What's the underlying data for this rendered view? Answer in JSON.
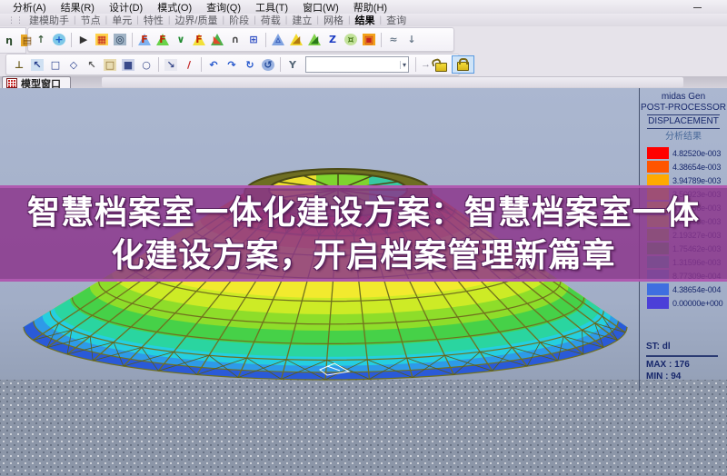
{
  "window": {
    "minimize_glyph": "—"
  },
  "menu": {
    "items": [
      "分析(A)",
      "结果(R)",
      "设计(D)",
      "模式(O)",
      "查询(Q)",
      "工具(T)",
      "窗口(W)",
      "帮助(H)"
    ]
  },
  "tab_strip": {
    "grip": "⋮⋮",
    "active_index": 9,
    "items": [
      "建模助手",
      "节点",
      "单元",
      "特性",
      "边界/质量",
      "阶段",
      "荷载",
      "建立",
      "网格",
      "结果",
      "查询"
    ]
  },
  "side_icons": [
    {
      "name": "eta-curve-icon",
      "glyph": "η",
      "color": "#2a4a2a",
      "shape": "none",
      "shape_color": ""
    },
    {
      "name": "orange-box-icon",
      "glyph": "▤",
      "color": "#7a4a0a",
      "shape": "rect",
      "shape_color": "#e8a82a"
    }
  ],
  "toolbar_results": {
    "icons": [
      {
        "name": "reaction-arrow-icon",
        "glyph": "↑",
        "color": "#3a5a3a",
        "shape": "none",
        "shape_color": ""
      },
      {
        "name": "node-web-icon",
        "glyph": "+",
        "color": "#1a5acc",
        "shape": "circ",
        "shape_color": "#7ec8e8"
      },
      {
        "sep": true
      },
      {
        "name": "animation-man-icon",
        "glyph": "▶",
        "color": "#333333",
        "shape": "none",
        "shape_color": ""
      },
      {
        "name": "result-table-icon",
        "glyph": "▦",
        "color": "#c22222",
        "shape": "rect",
        "shape_color": "#ffd24a"
      },
      {
        "name": "render-camera-icon",
        "glyph": "◎",
        "color": "#223a55",
        "shape": "rect",
        "shape_color": "#9fb2c4"
      },
      {
        "sep": true
      },
      {
        "name": "reaction-force-icon",
        "glyph": "F",
        "color": "#c22200",
        "shape": "tri",
        "shape_color": "#7fb2f0"
      },
      {
        "name": "deformed-shape-icon",
        "glyph": "F",
        "color": "#c22200",
        "shape": "tri",
        "shape_color": "#69d24a"
      },
      {
        "name": "displacement-curve-icon",
        "glyph": "∨",
        "color": "#1f8a2f",
        "shape": "none",
        "shape_color": ""
      },
      {
        "name": "moment-diagram-icon",
        "glyph": "F",
        "color": "#c22200",
        "shape": "tri",
        "shape_color": "#f2e03a"
      },
      {
        "name": "stress-wedge-icon",
        "glyph": "◣",
        "color": "#e04a2a",
        "shape": "tri",
        "shape_color": "#4ab24a"
      },
      {
        "name": "arc-arrow-icon",
        "glyph": "∩",
        "color": "#444444",
        "shape": "none",
        "shape_color": ""
      },
      {
        "name": "lattice-grid-icon",
        "glyph": "⊞",
        "color": "#2a4ac2",
        "shape": "none",
        "shape_color": ""
      },
      {
        "sep": true
      },
      {
        "name": "mode-shape-icon",
        "glyph": "▵",
        "color": "#2244aa",
        "shape": "tri",
        "shape_color": "#7fa2e0"
      },
      {
        "name": "yellow-wedge-icon",
        "glyph": "◢",
        "color": "#b27a10",
        "shape": "tri",
        "shape_color": "#f2d82a"
      },
      {
        "name": "green-wedge-icon",
        "glyph": "◢",
        "color": "#2a7a1a",
        "shape": "tri",
        "shape_color": "#7fd24a"
      },
      {
        "name": "z-displacement-icon",
        "glyph": "Z",
        "color": "#1a3ac2",
        "shape": "none",
        "shape_color": ""
      },
      {
        "name": "stage-pin-icon",
        "glyph": "¤",
        "color": "#4a7a1a",
        "shape": "circ",
        "shape_color": "#c2e29a"
      },
      {
        "name": "solid-cube-icon",
        "glyph": "▣",
        "color": "#c22222",
        "shape": "rect",
        "shape_color": "#f2a21a"
      },
      {
        "sep": true
      },
      {
        "name": "wave-function-icon",
        "glyph": "≈",
        "color": "#6a7a8a",
        "shape": "none",
        "shape_color": ""
      },
      {
        "name": "probe-result-icon",
        "glyph": "↓",
        "color": "#6a7a8a",
        "shape": "none",
        "shape_color": ""
      }
    ]
  },
  "toolbar_view": {
    "icons": [
      {
        "name": "plumb-pin-icon",
        "glyph": "⊥",
        "color": "#6a5a1a",
        "shape": "none",
        "shape_color": ""
      },
      {
        "name": "select-single-icon",
        "glyph": "↖",
        "color": "#223a8a",
        "shape": "rect",
        "shape_color": "#cfe0f2"
      },
      {
        "name": "select-window-icon",
        "glyph": "□",
        "color": "#223a8a",
        "shape": "none",
        "shape_color": ""
      },
      {
        "name": "select-polygon-icon",
        "glyph": "◇",
        "color": "#223a8a",
        "shape": "none",
        "shape_color": ""
      },
      {
        "name": "select-all-cursor-icon",
        "glyph": "↖",
        "color": "#555555",
        "shape": "none",
        "shape_color": ""
      },
      {
        "name": "select-plane-icon",
        "glyph": "□",
        "color": "#8a6a2a",
        "shape": "rect",
        "shape_color": "#e8dcb2"
      },
      {
        "name": "select-volume-icon",
        "glyph": "■",
        "color": "#3a4a8a",
        "shape": "rect",
        "shape_color": "#ccd2e8"
      },
      {
        "name": "select-circle-icon",
        "glyph": "○",
        "color": "#3a4a8a",
        "shape": "none",
        "shape_color": ""
      },
      {
        "sep": true
      },
      {
        "name": "zoom-window-icon",
        "glyph": "↘",
        "color": "#3a4a8a",
        "shape": "rect",
        "shape_color": "#e8e8f0"
      },
      {
        "name": "redraw-pencil-icon",
        "glyph": "/",
        "color": "#c22222",
        "shape": "none",
        "shape_color": ""
      },
      {
        "sep": true
      },
      {
        "name": "pan-back-icon",
        "glyph": "↶",
        "color": "#2255cc",
        "shape": "none",
        "shape_color": ""
      },
      {
        "name": "pan-forward-icon",
        "glyph": "↷",
        "color": "#2255cc",
        "shape": "none",
        "shape_color": ""
      },
      {
        "name": "rotate-cw-icon",
        "glyph": "↻",
        "color": "#2255cc",
        "shape": "none",
        "shape_color": ""
      },
      {
        "name": "rotate-view-icon",
        "glyph": "↺",
        "color": "#224a9a",
        "shape": "circ",
        "shape_color": "#9ab2e0"
      },
      {
        "sep": true
      },
      {
        "name": "named-view-icon",
        "glyph": "Y",
        "color": "#556677",
        "shape": "none",
        "shape_color": ""
      }
    ],
    "combo_value": "",
    "combo_caret": "▾",
    "fly_glyph": "→",
    "unlock_name": "unlock-icon",
    "lock_name": "lock-icon"
  },
  "model_tab": {
    "label": "模型窗口"
  },
  "legend": {
    "app": "midas Gen",
    "mode": "POST-PROCESSOR",
    "result_type": "DISPLACEMENT",
    "subtitle": "分析结果",
    "entries": [
      {
        "color": "#ff0000",
        "label": "4.82520e-003"
      },
      {
        "color": "#ff5500",
        "label": "4.38654e-003"
      },
      {
        "color": "#ffaa00",
        "label": "3.94789e-003"
      },
      {
        "color": "#ffd800",
        "label": "3.50923e-003"
      },
      {
        "color": "#fff000",
        "label": "3.07058e-003"
      },
      {
        "color": "#d5e81e",
        "label": "2.63193e-003"
      },
      {
        "color": "#8ed22b",
        "label": "2.19327e-003"
      },
      {
        "color": "#45c048",
        "label": "1.75462e-003"
      },
      {
        "color": "#2fc2a8",
        "label": "1.31596e-003"
      },
      {
        "color": "#3fa6e0",
        "label": "8.77309e-004"
      },
      {
        "color": "#3f6fe0",
        "label": "4.38654e-004"
      },
      {
        "color": "#4b3fd8",
        "label": "0.00000e+000"
      }
    ],
    "station": "ST: dl",
    "max": "MAX : 176",
    "min": "MIN : 94"
  },
  "banner": {
    "bg": "#8c348c",
    "lines": [
      "智慧档案室一体化建设方案：智慧档案室一体",
      "化建设方案，开启档案管理新篇章"
    ]
  },
  "dome": {
    "wire_color": "#70701e",
    "brace_color": "#5a5a16",
    "bands": [
      {
        "t": 0.0,
        "color": "#d23a28"
      },
      {
        "t": 0.055,
        "color": "#e87a1e"
      },
      {
        "t": 0.13,
        "color": "#f0b01e"
      },
      {
        "t": 0.2,
        "color": "#f2ea2e"
      },
      {
        "t": 0.5,
        "color": "#cdeb26"
      },
      {
        "t": 0.6,
        "color": "#8edd2a"
      },
      {
        "t": 0.7,
        "color": "#46d148"
      },
      {
        "t": 0.79,
        "color": "#2ad5a0"
      },
      {
        "t": 0.86,
        "color": "#25cfe0"
      },
      {
        "t": 0.915,
        "color": "#2e9ae8"
      },
      {
        "t": 0.955,
        "color": "#2a5ad8"
      }
    ],
    "ring": {
      "outer_color": "#6e6e22",
      "edge_color": "#4a4a16",
      "slices": [
        "#ecdf2e",
        "#7fd42f",
        "#38c9a2"
      ]
    }
  }
}
